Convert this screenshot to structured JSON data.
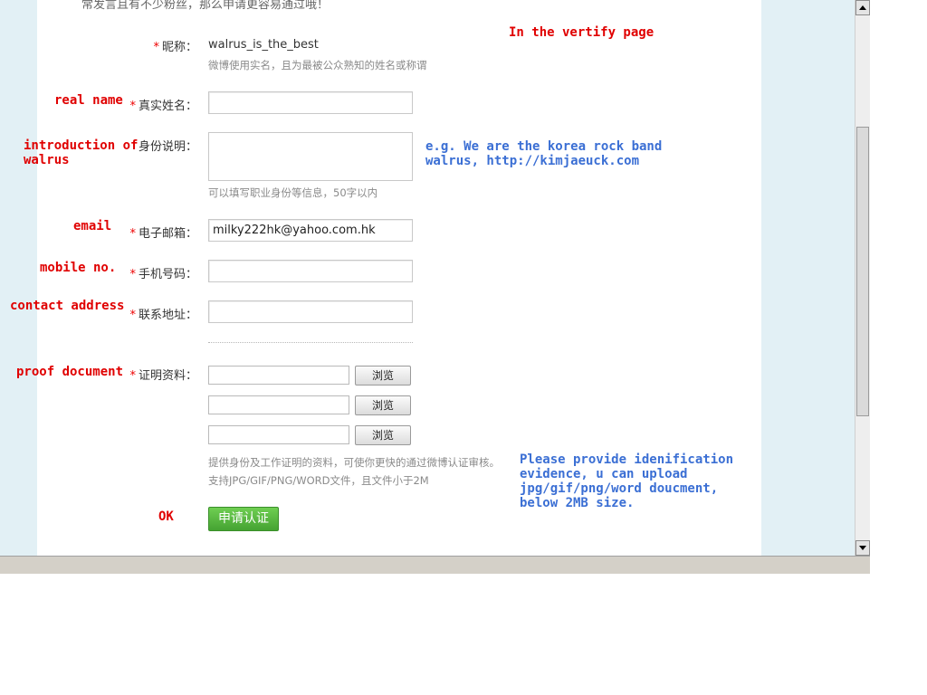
{
  "top_cut_text": "常发言且有不少粉丝，那么申请更容易通过哦！",
  "form": {
    "nickname": {
      "required": "*",
      "label": "昵称：",
      "value": "walrus_is_the_best",
      "hint": "微博使用实名，且为最被公众熟知的姓名或称谓"
    },
    "real_name": {
      "required": "*",
      "label": "真实姓名："
    },
    "identity": {
      "label": "身份说明：",
      "hint": "可以填写职业身份等信息，50字以内"
    },
    "email": {
      "required": "*",
      "label": "电子邮箱：",
      "value": "milky222hk@yahoo.com.hk"
    },
    "mobile": {
      "required": "*",
      "label": "手机号码："
    },
    "address": {
      "required": "*",
      "label": "联系地址："
    },
    "proof": {
      "required": "*",
      "label": "证明资料：",
      "browse_label": "浏览",
      "hint_line1": "提供身份及工作证明的资料，可使你更快的通过微博认证审核。",
      "hint_line2": "支持JPG/GIF/PNG/WORD文件，且文件小于2M"
    },
    "submit_label": "申请认证"
  },
  "annotations": {
    "red": {
      "vertify_page": "In the vertify page",
      "real_name": "real name",
      "intro_line1": "introduction of",
      "intro_line2": "walrus",
      "email": "email",
      "mobile": "mobile no.",
      "address": "contact address",
      "proof": "proof document",
      "ok": "OK"
    },
    "blue": {
      "example_line1": "e.g. We are the korea rock band",
      "example_line2": "walrus, http://kimjaeuck.com",
      "proof_line1": "Please provide idenification",
      "proof_line2": "evidence, u can upload",
      "proof_line3": "jpg/gif/png/word doucment,",
      "proof_line4": "below 2MB size."
    }
  },
  "icons": {
    "scroll_up": "scroll-up-arrow-icon",
    "scroll_down": "scroll-down-arrow-icon"
  }
}
